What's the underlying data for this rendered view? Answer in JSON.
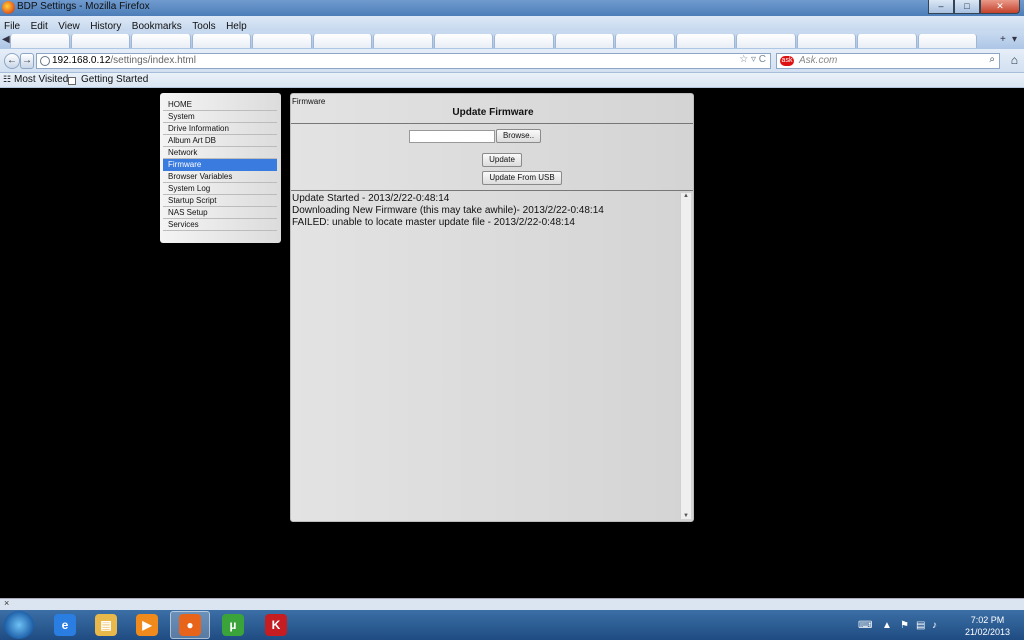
{
  "window": {
    "title": "BDP Settings - Mozilla Firefox",
    "min": "–",
    "max": "□",
    "close": "✕"
  },
  "menubar": [
    "File",
    "Edit",
    "View",
    "History",
    "Bookmarks",
    "Tools",
    "Help"
  ],
  "navbar": {
    "back": "←",
    "forward": "→",
    "url_host": "192.168.0.12",
    "url_path": "/settings/index.html",
    "star": "☆ ▿ C",
    "search_placeholder": "Ask.com",
    "search_engine_badge": "ask",
    "search_icon": "⌕",
    "home": "⌂"
  },
  "bookmarks": [
    "Most Visited",
    "Getting Started"
  ],
  "sidebar": {
    "items": [
      "HOME",
      "System",
      "Drive Information",
      "Album Art DB",
      "Network",
      "Firmware",
      "Browser Variables",
      "System Log",
      "Startup Script",
      "NAS Setup",
      "Services"
    ],
    "active": "Firmware"
  },
  "main": {
    "breadcrumb": "Firmware",
    "heading": "Update Firmware",
    "browse_label": "Browse..",
    "update_label": "Update",
    "usb_label": "Update From USB",
    "file_value": "",
    "log": [
      "Update Started - 2013/2/22-0:48:14",
      "Downloading New Firmware (this may take awhile)- 2013/2/22-0:48:14",
      "FAILED: unable to locate master update file - 2013/2/22-0:48:14"
    ]
  },
  "findbar": {
    "close": "×"
  },
  "taskbar": {
    "items": [
      {
        "name": "ie-icon",
        "glyph": "e",
        "color": "#2a7de1"
      },
      {
        "name": "explorer-icon",
        "glyph": "▤",
        "color": "#e8b84a"
      },
      {
        "name": "media-player-icon",
        "glyph": "▶",
        "color": "#f08a1c"
      },
      {
        "name": "firefox-icon",
        "glyph": "●",
        "color": "#e8641b"
      },
      {
        "name": "utorrent-icon",
        "glyph": "µ",
        "color": "#3aa33a"
      },
      {
        "name": "kaspersky-icon",
        "glyph": "K",
        "color": "#c51d22"
      }
    ],
    "active_item": "firefox-icon",
    "time": "7:02 PM",
    "date": "21/02/2013"
  }
}
